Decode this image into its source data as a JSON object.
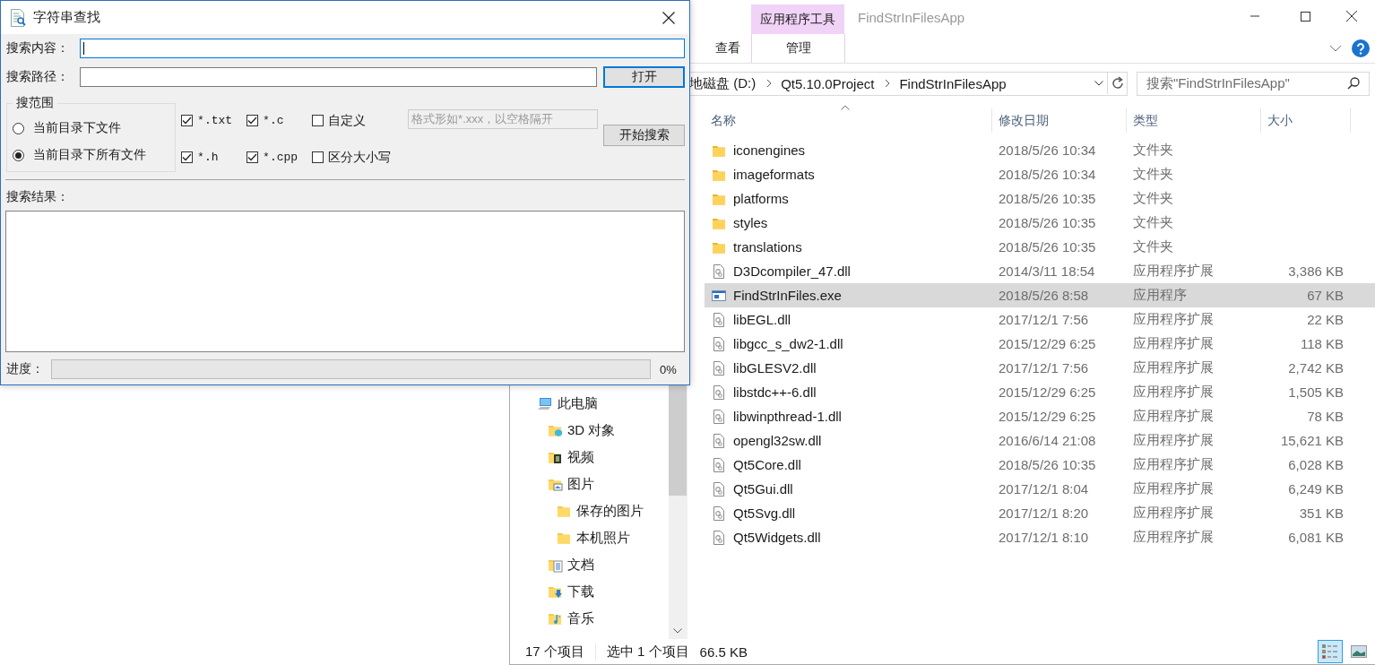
{
  "dialog": {
    "title": "字符串查找",
    "search_content": {
      "label": "搜索内容：",
      "focused": true
    },
    "search_path": {
      "label": "搜索路径："
    },
    "open_button": {
      "label": "打开",
      "focused": true
    },
    "scope": {
      "title": "搜范围",
      "options": [
        {
          "label": "当前目录下文件",
          "selected": false
        },
        {
          "label": "当前目录下所有文件",
          "selected": true
        }
      ]
    },
    "filters": [
      {
        "label": "*.txt",
        "checked": true,
        "kind": "pattern"
      },
      {
        "label": "*.c",
        "checked": true,
        "kind": "pattern"
      },
      {
        "label": "自定义",
        "checked": false,
        "kind": "text"
      },
      {
        "label": "*.h",
        "checked": true,
        "kind": "pattern"
      },
      {
        "label": "*.cpp",
        "checked": true,
        "kind": "pattern"
      },
      {
        "label": "区分大小写",
        "checked": false,
        "kind": "text"
      }
    ],
    "custom_pattern": {
      "placeholder": "格式形如*.xxx，以空格隔开",
      "disabled": true
    },
    "start_button": "开始搜索",
    "results": {
      "label": "搜索结果："
    },
    "progress": {
      "label": "进度：",
      "level": 0,
      "reading": "0%"
    }
  },
  "explorer": {
    "context_tab": "应用程序工具",
    "title": "FindStrInFilesApp",
    "ribbon_tabs": [
      {
        "label": "查看",
        "kind": "normal"
      },
      {
        "label": "管理",
        "kind": "context"
      }
    ],
    "address": [
      "地磁盘 (D:)",
      "Qt5.10.0Project",
      "FindStrInFilesApp"
    ],
    "search": {
      "placeholder": "搜索\"FindStrInFilesApp\""
    },
    "columns": [
      "名称",
      "修改日期",
      "类型",
      "大小"
    ],
    "files": [
      {
        "name": "iconengines",
        "modified": "2018/5/26 10:34",
        "type": "文件夹",
        "kind": "folder",
        "selected": false
      },
      {
        "name": "imageformats",
        "modified": "2018/5/26 10:34",
        "type": "文件夹",
        "kind": "folder",
        "selected": false
      },
      {
        "name": "platforms",
        "modified": "2018/5/26 10:35",
        "type": "文件夹",
        "kind": "folder",
        "selected": false
      },
      {
        "name": "styles",
        "modified": "2018/5/26 10:35",
        "type": "文件夹",
        "kind": "folder",
        "selected": false
      },
      {
        "name": "translations",
        "modified": "2018/5/26 10:35",
        "type": "文件夹",
        "kind": "folder",
        "selected": false
      },
      {
        "name": "D3Dcompiler_47.dll",
        "modified": "2014/3/11 18:54",
        "type": "应用程序扩展",
        "size": "3,386 KB",
        "kind": "dll",
        "selected": false
      },
      {
        "name": "FindStrInFiles.exe",
        "modified": "2018/5/26 8:58",
        "type": "应用程序",
        "size": "67 KB",
        "kind": "exe",
        "selected": true
      },
      {
        "name": "libEGL.dll",
        "modified": "2017/12/1 7:56",
        "type": "应用程序扩展",
        "size": "22 KB",
        "kind": "dll",
        "selected": false
      },
      {
        "name": "libgcc_s_dw2-1.dll",
        "modified": "2015/12/29 6:25",
        "type": "应用程序扩展",
        "size": "118 KB",
        "kind": "dll",
        "selected": false
      },
      {
        "name": "libGLESV2.dll",
        "modified": "2017/12/1 7:56",
        "type": "应用程序扩展",
        "size": "2,742 KB",
        "kind": "dll",
        "selected": false
      },
      {
        "name": "libstdc++-6.dll",
        "modified": "2015/12/29 6:25",
        "type": "应用程序扩展",
        "size": "1,505 KB",
        "kind": "dll",
        "selected": false
      },
      {
        "name": "libwinpthread-1.dll",
        "modified": "2015/12/29 6:25",
        "type": "应用程序扩展",
        "size": "78 KB",
        "kind": "dll",
        "selected": false
      },
      {
        "name": "opengl32sw.dll",
        "modified": "2016/6/14 21:08",
        "type": "应用程序扩展",
        "size": "15,621 KB",
        "kind": "dll",
        "selected": false
      },
      {
        "name": "Qt5Core.dll",
        "modified": "2018/5/26 10:35",
        "type": "应用程序扩展",
        "size": "6,028 KB",
        "kind": "dll",
        "selected": false
      },
      {
        "name": "Qt5Gui.dll",
        "modified": "2017/12/1 8:04",
        "type": "应用程序扩展",
        "size": "6,249 KB",
        "kind": "dll",
        "selected": false
      },
      {
        "name": "Qt5Svg.dll",
        "modified": "2017/12/1 8:20",
        "type": "应用程序扩展",
        "size": "351 KB",
        "kind": "dll",
        "selected": false
      },
      {
        "name": "Qt5Widgets.dll",
        "modified": "2017/12/1 8:10",
        "type": "应用程序扩展",
        "size": "6,081 KB",
        "kind": "dll",
        "selected": false
      }
    ],
    "nav": [
      {
        "label": "此电脑",
        "kind": "pc",
        "children": [
          {
            "label": "3D 对象",
            "kind": "objects"
          },
          {
            "label": "视频",
            "kind": "video"
          },
          {
            "label": "图片",
            "kind": "pictures",
            "children": [
              {
                "label": "保存的图片",
                "kind": "folder"
              },
              {
                "label": "本机照片",
                "kind": "folder"
              }
            ]
          },
          {
            "label": "文档",
            "kind": "documents"
          },
          {
            "label": "下载",
            "kind": "downloads"
          },
          {
            "label": "音乐",
            "kind": "music"
          }
        ]
      }
    ],
    "status": {
      "count": "17 个项目",
      "selection": "选中 1 个项目",
      "size": "66.5 KB"
    },
    "views": [
      {
        "kind": "details",
        "selected": true
      },
      {
        "kind": "thumbnails",
        "selected": false
      }
    ]
  }
}
